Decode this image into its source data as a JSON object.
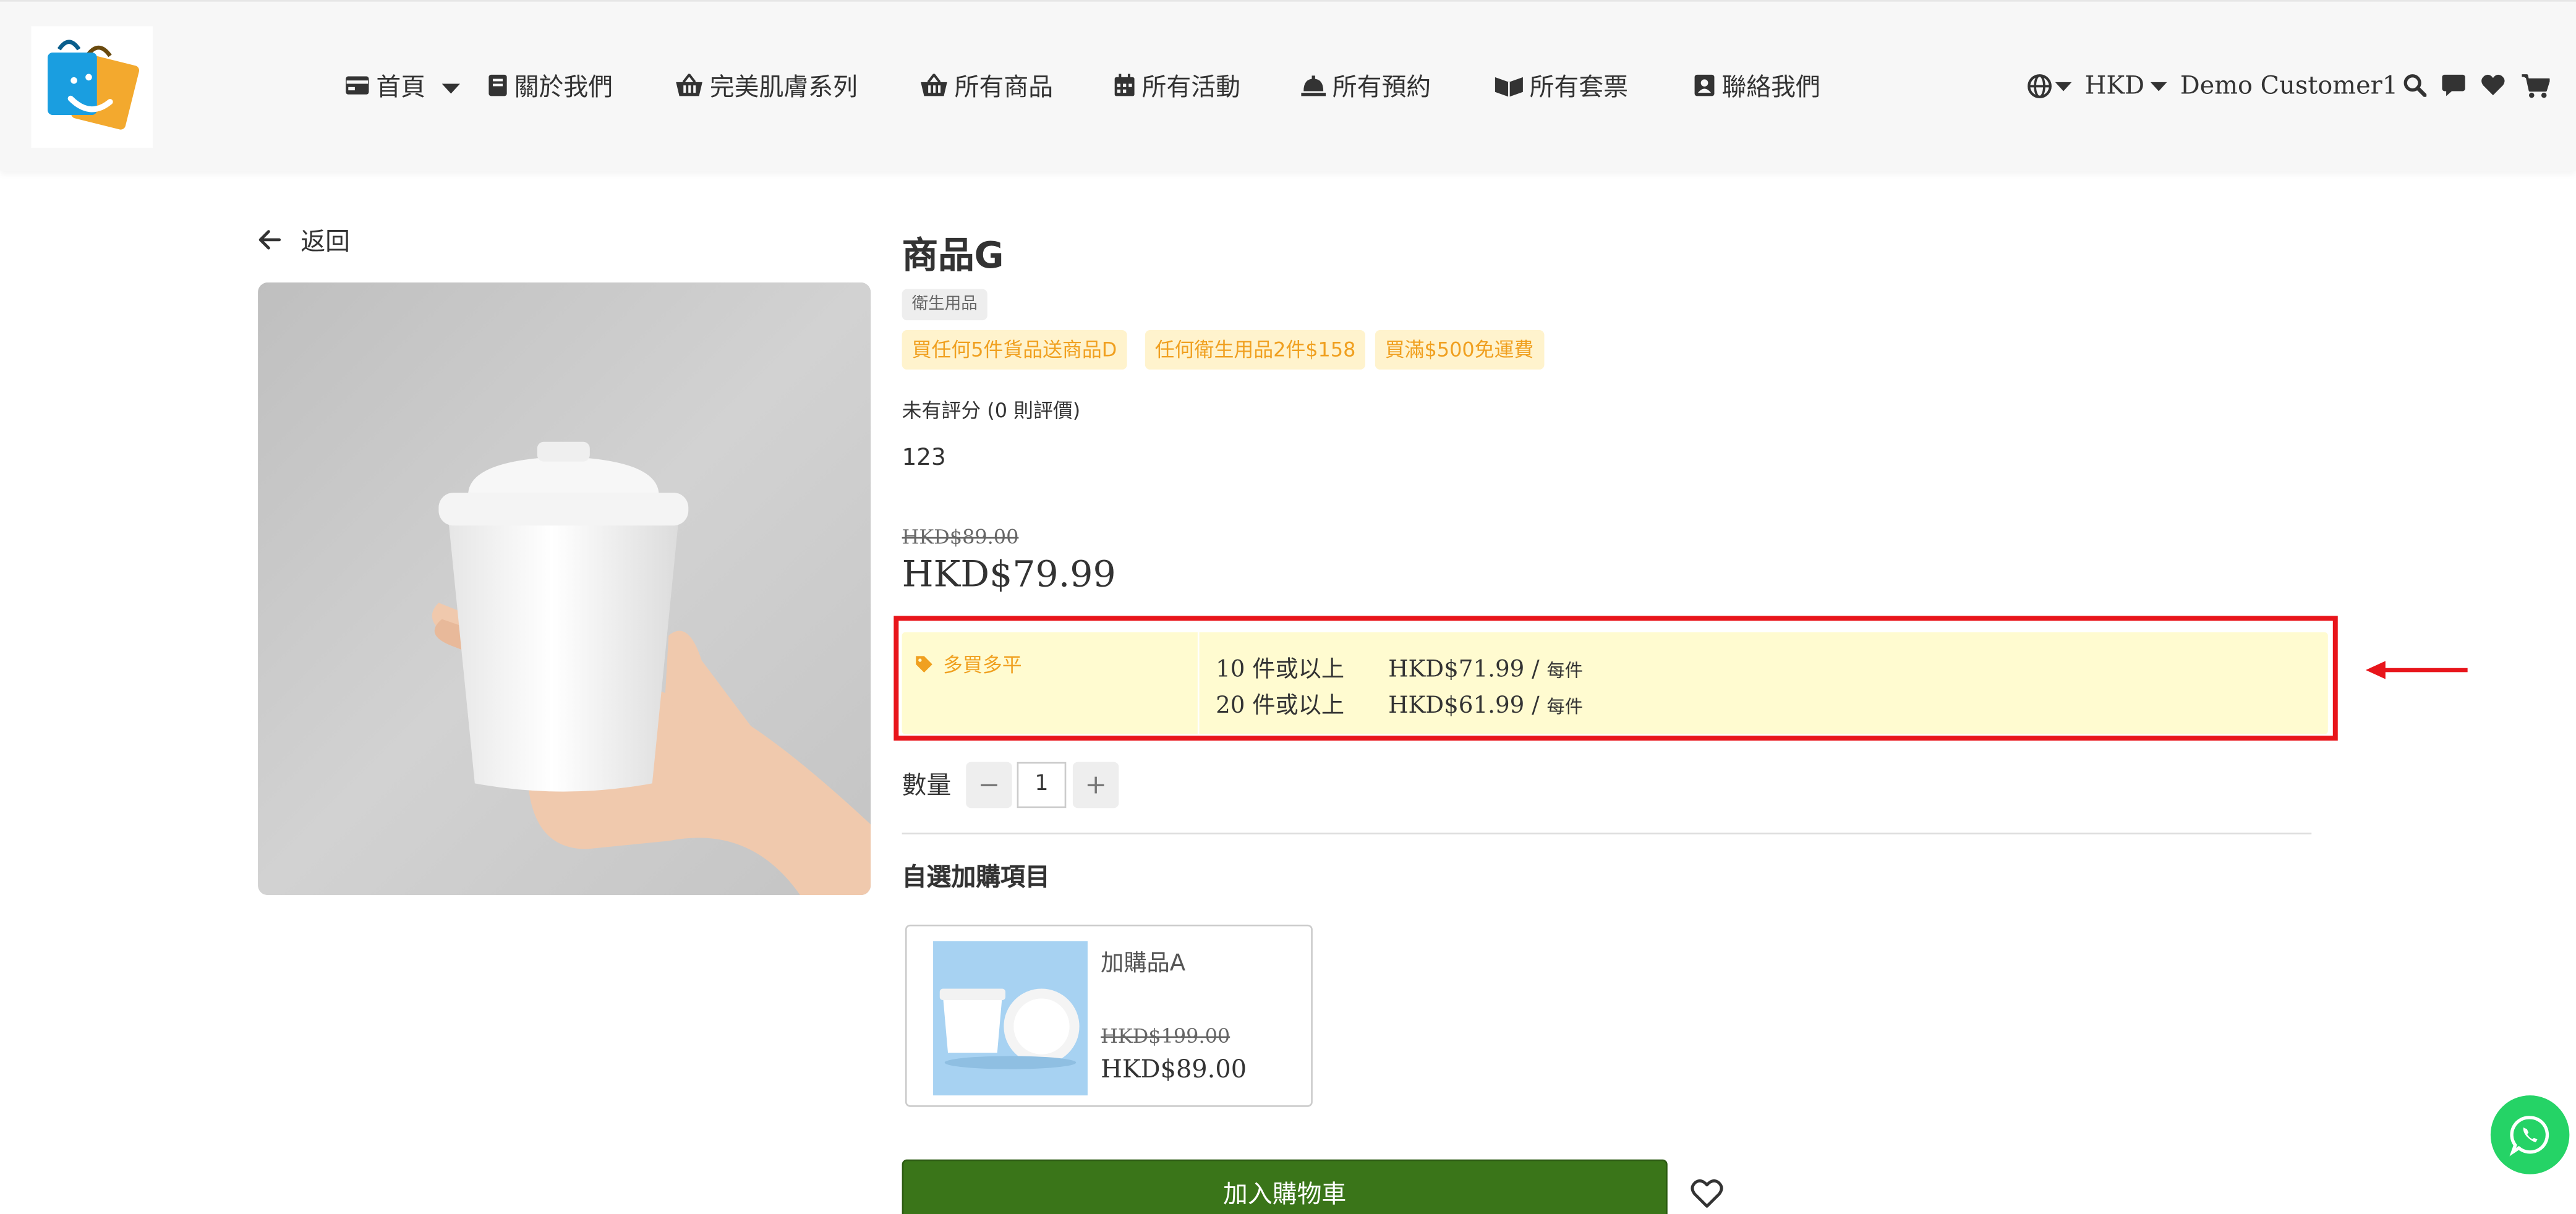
{
  "header": {
    "logo_icon": "shopping-bags-logo",
    "nav": [
      {
        "label": "首頁",
        "icon": "credit-card-icon",
        "has_dropdown": true
      },
      {
        "label": "關於我們",
        "icon": "book-icon"
      },
      {
        "label": "完美肌膚系列",
        "icon": "basket-icon"
      },
      {
        "label": "所有商品",
        "icon": "basket-icon"
      },
      {
        "label": "所有活動",
        "icon": "calendar-icon"
      },
      {
        "label": "所有預約",
        "icon": "bell-icon"
      },
      {
        "label": "所有套票",
        "icon": "ticket-icon"
      },
      {
        "label": "聯絡我們",
        "icon": "contact-card-icon"
      }
    ],
    "currency": "HKD",
    "user": "Demo Customer1"
  },
  "back_label": "返回",
  "product": {
    "title": "商品G",
    "category_tag": "衛生用品",
    "promotions": [
      "買任何5件貨品送商品D",
      "任何衛生用品2件$158",
      "買滿$500免運費"
    ],
    "rating_text": "未有評分 (0 則評價)",
    "description": "123",
    "original_price": "HKD$89.00",
    "price": "HKD$79.99",
    "bulk": {
      "label": "多買多平",
      "tiers": [
        {
          "qty": "10 件或以上",
          "price": "HKD$71.99",
          "sep": " / ",
          "unit": "每件"
        },
        {
          "qty": "20 件或以上",
          "price": "HKD$61.99",
          "sep": " / ",
          "unit": "每件"
        }
      ]
    },
    "quantity_label": "數量",
    "quantity_value": "1",
    "qty_minus": "−",
    "qty_plus": "+",
    "addon_title": "自選加購項目",
    "addon": {
      "name": "加購品A",
      "original_price": "HKD$199.00",
      "price": "HKD$89.00"
    },
    "add_to_cart": "加入購物車"
  },
  "colors": {
    "accent_green": "#3a7519",
    "promo_text": "#f0a020",
    "promo_bg": "#fff3cd",
    "bulk_bg": "#fffbd0",
    "highlight_red": "#e8151b",
    "whatsapp": "#25d366"
  }
}
